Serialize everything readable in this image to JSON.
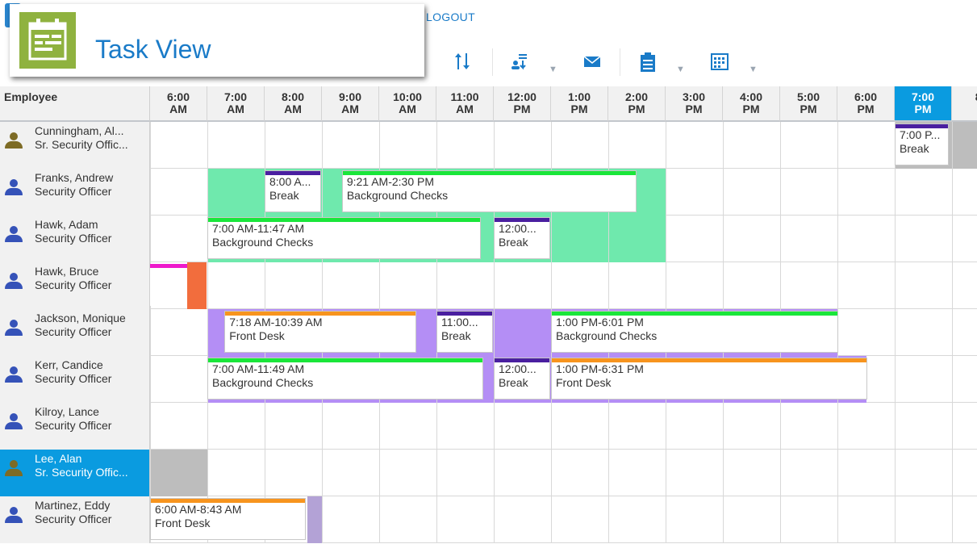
{
  "header": {
    "logout_label": "LOGOUT"
  },
  "popup": {
    "title": "Task View"
  },
  "grid": {
    "employee_header": "Employee",
    "columns": [
      {
        "l1": "6:00",
        "l2": "AM"
      },
      {
        "l1": "7:00",
        "l2": "AM"
      },
      {
        "l1": "8:00",
        "l2": "AM"
      },
      {
        "l1": "9:00",
        "l2": "AM"
      },
      {
        "l1": "10:00",
        "l2": "AM"
      },
      {
        "l1": "11:00",
        "l2": "AM"
      },
      {
        "l1": "12:00",
        "l2": "PM"
      },
      {
        "l1": "1:00",
        "l2": "PM"
      },
      {
        "l1": "2:00",
        "l2": "PM"
      },
      {
        "l1": "3:00",
        "l2": "PM"
      },
      {
        "l1": "4:00",
        "l2": "PM"
      },
      {
        "l1": "5:00",
        "l2": "PM"
      },
      {
        "l1": "6:00",
        "l2": "PM"
      },
      {
        "l1": "7:00",
        "l2": "PM",
        "current": true
      },
      {
        "l1": "8:",
        "l2": "P"
      }
    ],
    "rows": [
      {
        "name": "Cunningham, Al...",
        "role": "Sr. Security Offic...",
        "senior": true,
        "selected": false,
        "bgs": [
          {
            "s": 19.0,
            "e": 20.5,
            "c": "#bdbdbd"
          }
        ],
        "tasks": [
          {
            "s": 19.0,
            "e": 19.95,
            "t1": "7:00 P...",
            "t2": "Break",
            "bar": "#4a1fa0"
          }
        ]
      },
      {
        "name": "Franks, Andrew",
        "role": "Security Officer",
        "senior": false,
        "selected": false,
        "bgs": [
          {
            "s": 7.0,
            "e": 15.0,
            "c": "#6fe9ad"
          }
        ],
        "tasks": [
          {
            "s": 8.0,
            "e": 8.98,
            "t1": "8:00 A...",
            "t2": "Break",
            "bar": "#4a1fa0"
          },
          {
            "s": 9.35,
            "e": 14.5,
            "t1": "9:21 AM-2:30 PM",
            "t2": "Background Checks",
            "bar": "#1ae63a"
          }
        ]
      },
      {
        "name": "Hawk, Adam",
        "role": "Security Officer",
        "senior": false,
        "selected": false,
        "bgs": [
          {
            "s": 7.0,
            "e": 15.0,
            "c": "#6fe9ad"
          }
        ],
        "tasks": [
          {
            "s": 7.0,
            "e": 11.78,
            "t1": "7:00 AM-11:47 AM",
            "t2": "Background Checks",
            "bar": "#1ae63a"
          },
          {
            "s": 12.0,
            "e": 12.98,
            "t1": "12:00...",
            "t2": "Break",
            "bar": "#4a1fa0"
          }
        ]
      },
      {
        "name": "Hawk, Bruce",
        "role": "Security Officer",
        "senior": false,
        "selected": false,
        "bgs": [
          {
            "s": 6.65,
            "e": 6.98,
            "c": "#f26d3d"
          }
        ],
        "tasks": [
          {
            "s": 6.0,
            "e": 6.65,
            "t1": "",
            "t2": "",
            "bar": "#ee1acb"
          }
        ]
      },
      {
        "name": "Jackson, Monique",
        "role": "Security Officer",
        "senior": false,
        "selected": false,
        "bgs": [
          {
            "s": 7.0,
            "e": 18.0,
            "c": "#b48ef5"
          }
        ],
        "tasks": [
          {
            "s": 7.3,
            "e": 10.65,
            "t1": "7:18 AM-10:39 AM",
            "t2": "Front Desk",
            "bar": "#f7941e"
          },
          {
            "s": 11.0,
            "e": 11.98,
            "t1": "11:00...",
            "t2": "Break",
            "bar": "#4a1fa0"
          },
          {
            "s": 13.0,
            "e": 18.02,
            "t1": "1:00 PM-6:01 PM",
            "t2": "Background Checks",
            "bar": "#1ae63a"
          }
        ]
      },
      {
        "name": "Kerr, Candice",
        "role": "Security Officer",
        "senior": false,
        "selected": false,
        "bgs": [
          {
            "s": 7.0,
            "e": 18.5,
            "c": "#b48ef5"
          }
        ],
        "tasks": [
          {
            "s": 7.0,
            "e": 11.82,
            "t1": "7:00 AM-11:49 AM",
            "t2": "Background Checks",
            "bar": "#1ae63a"
          },
          {
            "s": 12.0,
            "e": 12.98,
            "t1": "12:00...",
            "t2": "Break",
            "bar": "#4a1fa0"
          },
          {
            "s": 13.0,
            "e": 18.52,
            "t1": "1:00 PM-6:31 PM",
            "t2": "Front Desk",
            "bar": "#f7941e"
          }
        ]
      },
      {
        "name": "Kilroy, Lance",
        "role": "Security Officer",
        "senior": false,
        "selected": false,
        "bgs": [],
        "tasks": []
      },
      {
        "name": "Lee, Alan",
        "role": "Sr. Security Offic...",
        "senior": true,
        "selected": true,
        "bgs": [
          {
            "s": 6.0,
            "e": 7.0,
            "c": "#bdbdbd"
          }
        ],
        "tasks": []
      },
      {
        "name": "Martinez, Eddy",
        "role": "Security Officer",
        "senior": false,
        "selected": false,
        "bgs": [
          {
            "s": 8.75,
            "e": 9.0,
            "c": "#b3a2d6"
          }
        ],
        "tasks": [
          {
            "s": 6.0,
            "e": 8.72,
            "t1": "6:00 AM-8:43 AM",
            "t2": "Front Desk",
            "bar": "#f7941e"
          }
        ]
      }
    ]
  },
  "toolbar": {
    "icons": [
      "sort-icon",
      "assign-icon",
      "mail-icon",
      "clipboard-icon",
      "calendar-grid-icon"
    ]
  }
}
